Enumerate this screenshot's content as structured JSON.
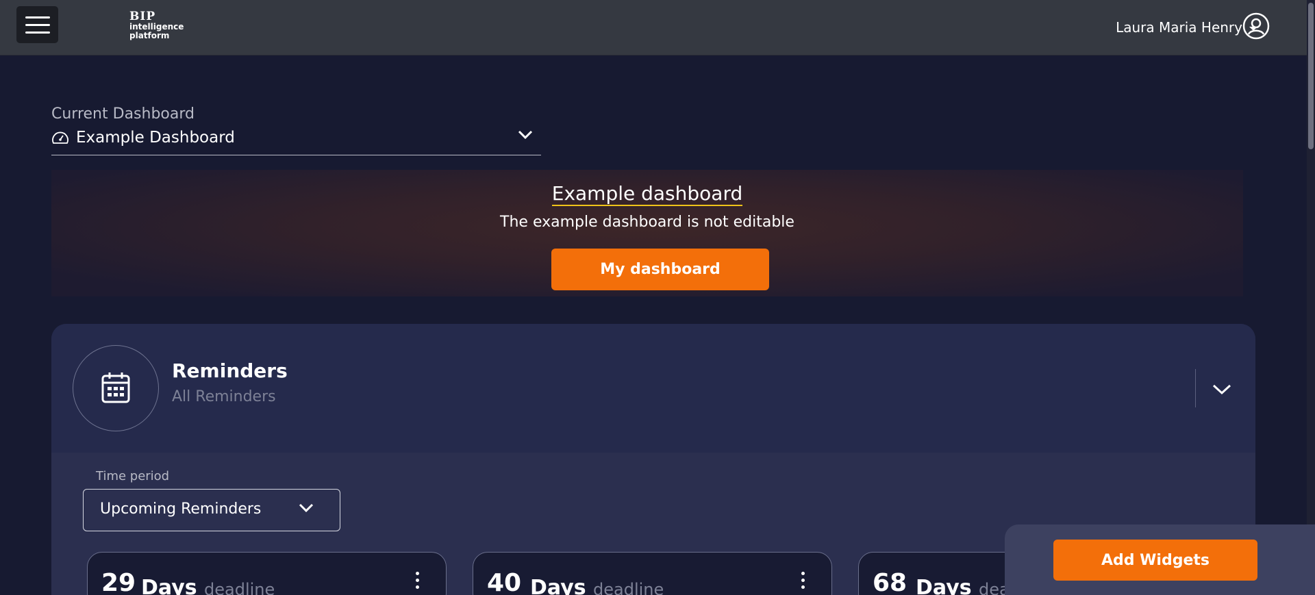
{
  "header": {
    "logo_mark": "BIP",
    "logo_line1": "intelligence",
    "logo_line2": "platform",
    "user_name": "Laura Maria Henry"
  },
  "dashboard_select": {
    "label": "Current Dashboard",
    "value": "Example Dashboard"
  },
  "banner": {
    "title": "Example dashboard",
    "subtitle": "The example dashboard is not editable",
    "button_label": "My dashboard"
  },
  "reminders": {
    "title": "Reminders",
    "subtitle": "All Reminders",
    "time_period_label": "Time period",
    "time_period_value": "Upcoming Reminders",
    "cards": [
      {
        "number": "29",
        "unit": "Days",
        "suffix": "deadline"
      },
      {
        "number": "40",
        "unit": "Days",
        "suffix": "deadline"
      },
      {
        "number": "68",
        "unit": "Days",
        "suffix": "deadline"
      }
    ]
  },
  "add_widgets_label": "Add Widgets",
  "colors": {
    "accent": "#f36f0a",
    "background": "#171a31",
    "topbar": "#353941",
    "panel": "#23284a"
  }
}
